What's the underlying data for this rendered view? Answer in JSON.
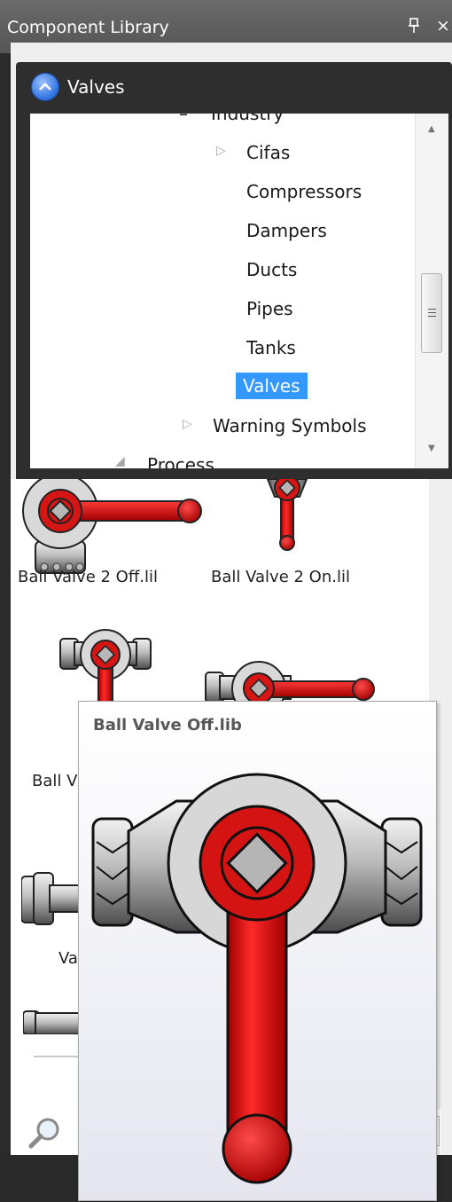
{
  "window": {
    "title": "Component Library",
    "pin_glyph": "❘",
    "close_glyph": "×"
  },
  "section": {
    "title": "Valves",
    "chevron_icon": "chevron-up-icon"
  },
  "tree": {
    "parent_label": "Industry",
    "children": [
      "Cifas",
      "Compressors",
      "Dampers",
      "Ducts",
      "Pipes",
      "Tanks",
      "Valves"
    ],
    "selected": "Valves",
    "sibling": "Warning Symbols",
    "next_group": "Process"
  },
  "items": [
    {
      "label": "Ball Valve 2 Off.lil"
    },
    {
      "label": "Ball Valve 2 On.lil"
    },
    {
      "label": "Ball V"
    },
    {
      "label": "Va"
    }
  ],
  "tooltip": {
    "title": "Ball Valve Off.lib"
  },
  "search": {
    "icon": "search-icon"
  },
  "colors": {
    "selection": "#3399ff",
    "valve_red": "#cc1a1a",
    "header_dark": "#2e2e2e",
    "titlebar": "#5e5e5e"
  }
}
